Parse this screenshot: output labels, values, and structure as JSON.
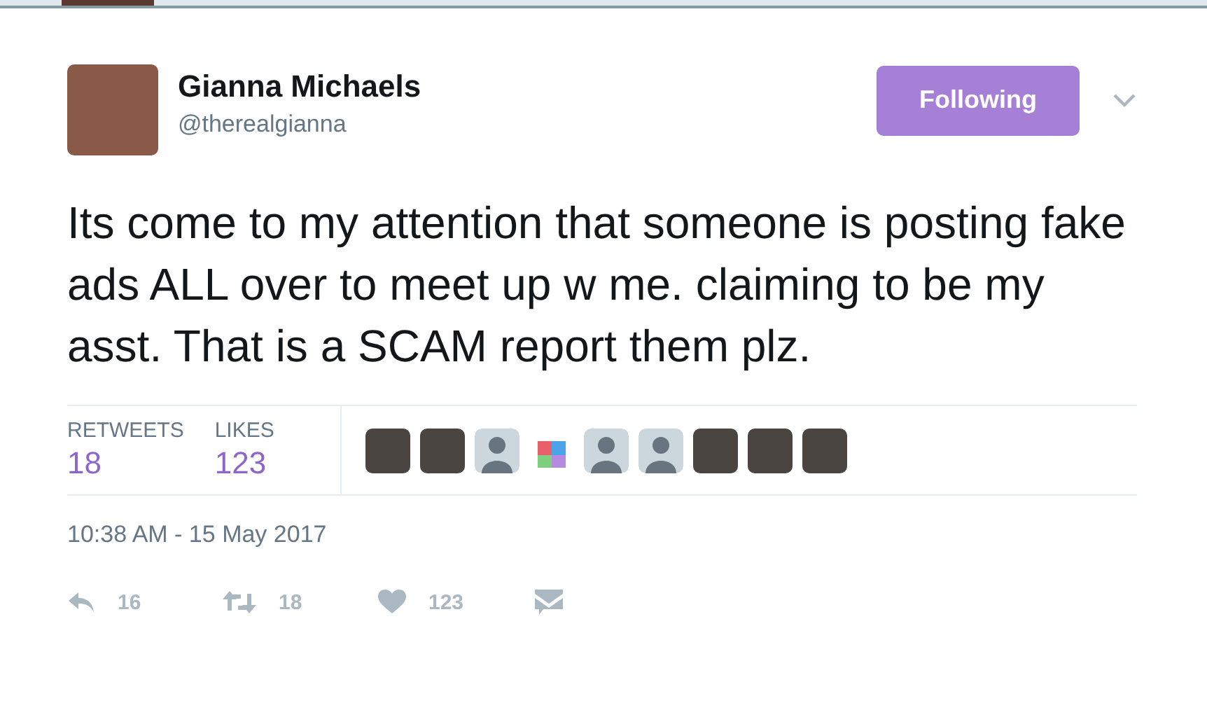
{
  "author": {
    "name": "Gianna Michaels",
    "handle": "@therealgianna"
  },
  "follow_button": {
    "label": "Following",
    "selected": true
  },
  "tweet_text": "Its come to my attention that someone is posting fake ads ALL over to meet up w me. claiming to be my asst. That is a SCAM report them plz.",
  "stats": [
    {
      "label": "RETWEETS",
      "value": "18"
    },
    {
      "label": "LIKES",
      "value": "123"
    }
  ],
  "likers": [
    {
      "kind": "photo"
    },
    {
      "kind": "photo"
    },
    {
      "kind": "default"
    },
    {
      "kind": "graphic"
    },
    {
      "kind": "default"
    },
    {
      "kind": "default"
    },
    {
      "kind": "photo"
    },
    {
      "kind": "photo"
    },
    {
      "kind": "photo"
    }
  ],
  "timestamp": "10:38 AM - 15 May 2017",
  "actions": [
    {
      "kind": "reply",
      "count": "16"
    },
    {
      "kind": "retweet",
      "count": "18"
    },
    {
      "kind": "like",
      "count": "123"
    },
    {
      "kind": "message"
    }
  ]
}
